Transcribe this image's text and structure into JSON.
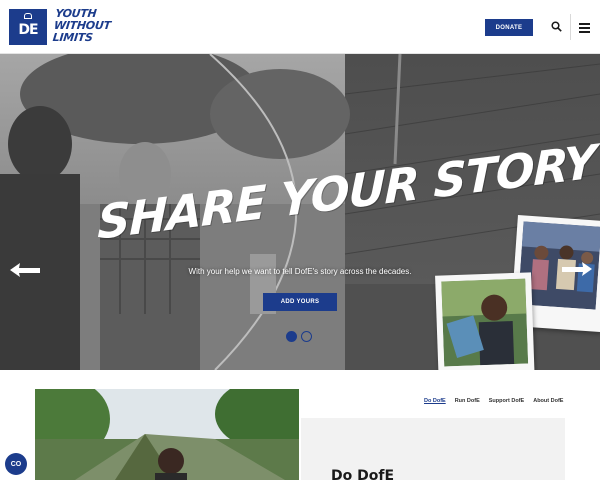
{
  "header": {
    "logo_text": "DE",
    "tagline": [
      "YOUTH",
      "WITHOUT",
      "LIMITS"
    ],
    "donate_label": "DONATE"
  },
  "hero": {
    "title": "SHARE YOUR STORY",
    "subtitle": "With your help we want to tell DofE's story across the decades.",
    "cta_label": "ADD YOURS",
    "slide_count": 2,
    "active_slide": 1
  },
  "subnav": {
    "items": [
      "Do DofE",
      "Run DofE",
      "Support DofE",
      "About DofE"
    ],
    "active": "Do DofE"
  },
  "panel": {
    "title": "Do DofE"
  },
  "colors": {
    "brand_blue": "#1c3c8c",
    "white": "#ffffff",
    "panel_grey": "#f2f2f2"
  },
  "icons": [
    "search-icon",
    "menu-icon",
    "arrow-left-icon",
    "arrow-right-icon",
    "captions-icon"
  ],
  "accessibility": {
    "captions_label": "CO"
  }
}
